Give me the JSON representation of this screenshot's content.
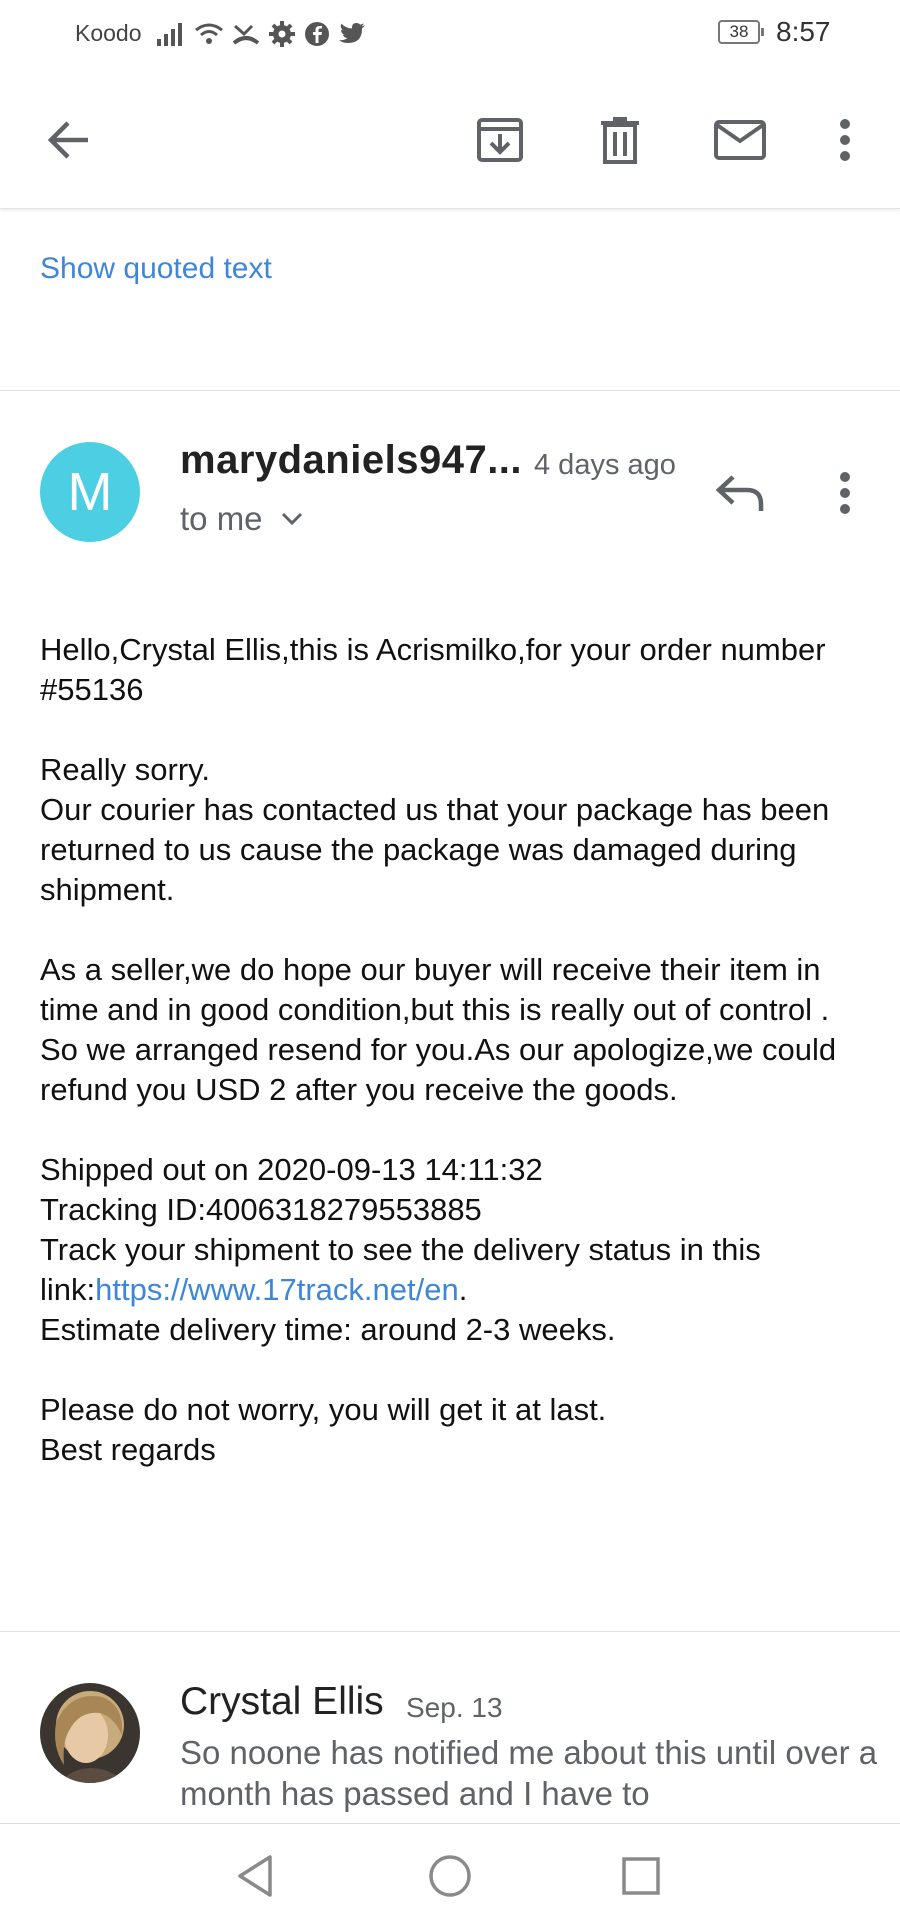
{
  "status_bar": {
    "carrier": "Koodo",
    "battery": "38",
    "time": "8:57",
    "icons": [
      "signal-icon",
      "wifi-icon",
      "missed-call-icon",
      "settings-icon",
      "facebook-icon",
      "twitter-icon"
    ]
  },
  "toolbar": {
    "icons": [
      "back-arrow-icon",
      "archive-icon",
      "delete-icon",
      "mark-unread-icon",
      "more-vert-icon"
    ]
  },
  "thread": {
    "show_quoted_text": "Show quoted text"
  },
  "message": {
    "avatar_letter": "M",
    "avatar_color": "#4ccfe3",
    "sender": "marydaniels947...",
    "time": "4 days ago",
    "recipients": "to me",
    "body": {
      "greeting": "Hello,Crystal Ellis,this is Acrismilko,for your order number #55136",
      "sorry": "Really sorry.",
      "courier": "Our courier has contacted us that your package has been returned to us cause the package was damaged during shipment.",
      "seller": "As a seller,we do hope our buyer will receive their item in time and in good condition,but this is really out of control .",
      "resend": "So we arranged resend for you.As our apologize,we could refund you USD 2 after you receive the goods.",
      "shipped": "Shipped out on 2020-09-13 14:11:32",
      "tracking": "Tracking ID:4006318279553885",
      "track_prefix": "Track your shipment to see the delivery status in this link:",
      "track_link": "https://www.17track.net/en",
      "track_suffix": ".",
      "estimate": "Estimate delivery time: around 2-3 weeks.",
      "reassure": "Please do not worry, you will get it at last.",
      "signoff": "Best regards"
    }
  },
  "reply_preview": {
    "name": "Crystal Ellis",
    "date": "Sep. 13",
    "snippet": "So noone has notified me about this until over a month has passed and I have to"
  },
  "nav_bar": {
    "icons": [
      "nav-back-icon",
      "nav-home-icon",
      "nav-recents-icon"
    ]
  },
  "colors": {
    "link": "#3f86d8",
    "icon_gray": "#5f6368"
  }
}
